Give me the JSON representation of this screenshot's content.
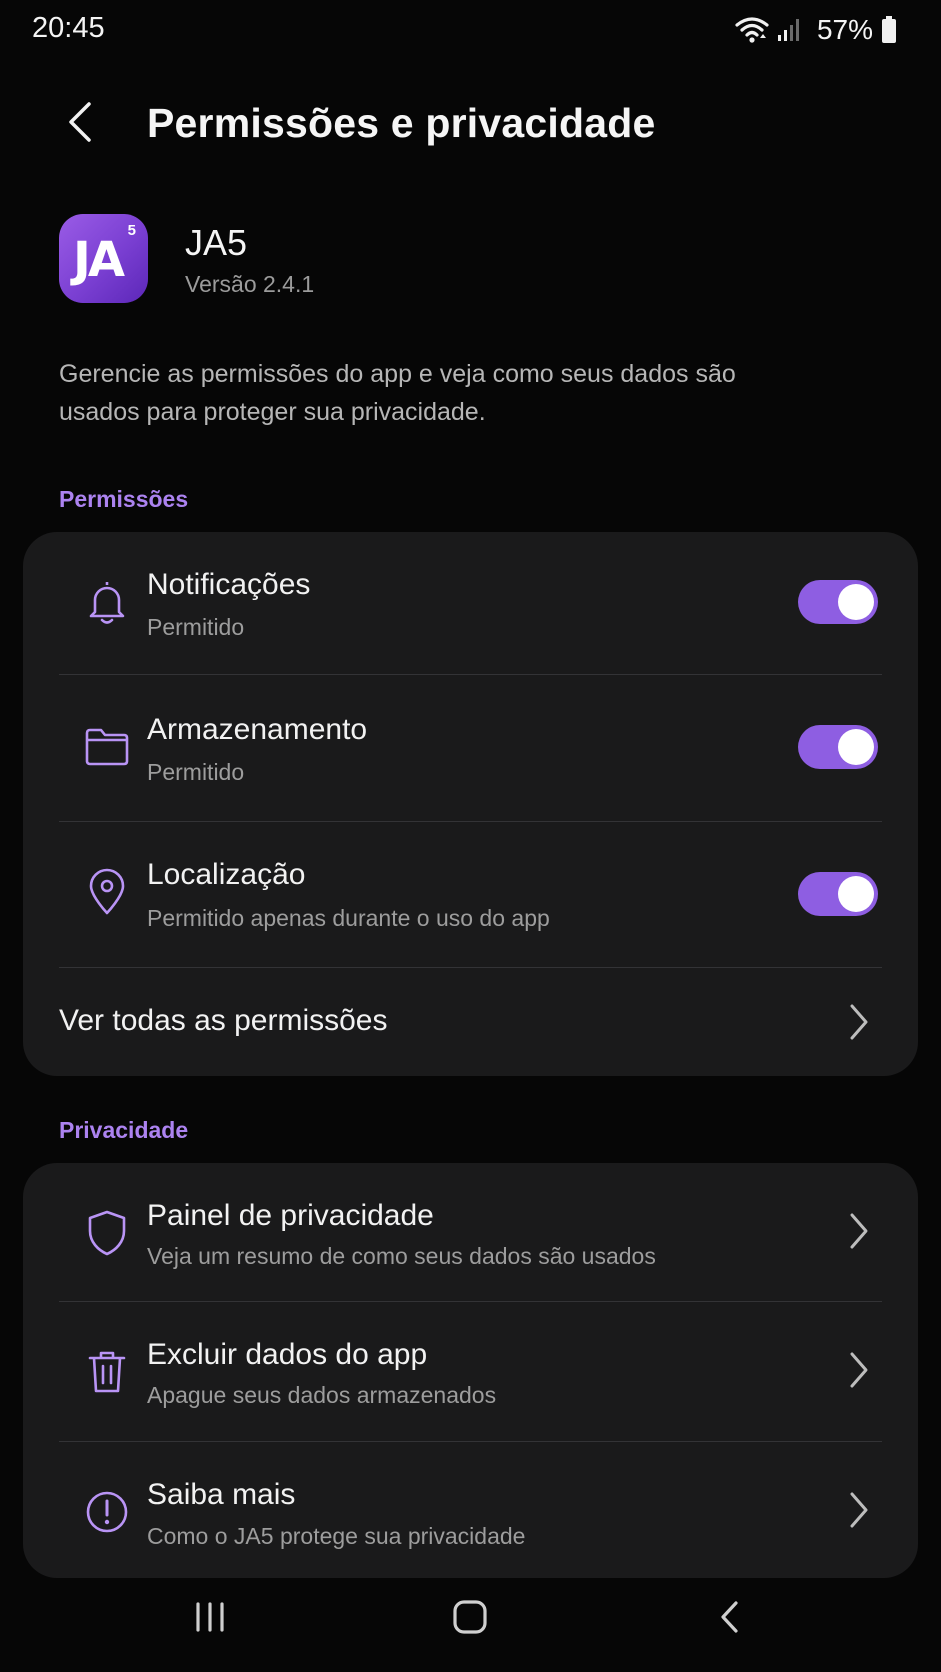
{
  "status_bar": {
    "time": "20:45",
    "battery": "57%",
    "icons": [
      "wifi-icon",
      "signal-icon",
      "battery-icon"
    ]
  },
  "header": {
    "title": "Permissões e privacidade",
    "back_icon": "back-arrow-icon"
  },
  "app": {
    "name": "JA5",
    "version": "Versão 2.4.1",
    "icon_text": "JA",
    "icon_superscript": "5"
  },
  "intro": "Gerencie as permissões do app e veja como seus dados são usados para proteger sua privacidade.",
  "permissions": {
    "section_title": "Permissões",
    "items": [
      {
        "title": "Notificações",
        "subtitle": "Permitido",
        "icon": "bell-icon",
        "enabled": true
      },
      {
        "title": "Armazenamento",
        "subtitle": "Permitido",
        "icon": "folder-icon",
        "enabled": true
      },
      {
        "title": "Localização",
        "subtitle": "Permitido apenas durante o uso do app",
        "icon": "location-pin-icon",
        "enabled": true
      }
    ],
    "see_all": "Ver todas as permissões"
  },
  "privacy": {
    "section_title": "Privacidade",
    "items": [
      {
        "title": "Painel de privacidade",
        "subtitle": "Veja um resumo de como seus dados são usados",
        "icon": "shield-icon"
      },
      {
        "title": "Excluir dados do app",
        "subtitle": "Apague seus dados armazenados",
        "icon": "trash-icon"
      },
      {
        "title": "Saiba mais",
        "subtitle": "Como o JA5 protege sua privacidade",
        "icon": "info-exclamation-icon"
      }
    ]
  },
  "nav_bar": {
    "buttons": [
      "recents-icon",
      "home-icon",
      "back-icon"
    ]
  },
  "colors": {
    "accent": "#8e5ee2",
    "section_title": "#ac83f0",
    "background": "#060606",
    "card": "#1a1a1b"
  }
}
